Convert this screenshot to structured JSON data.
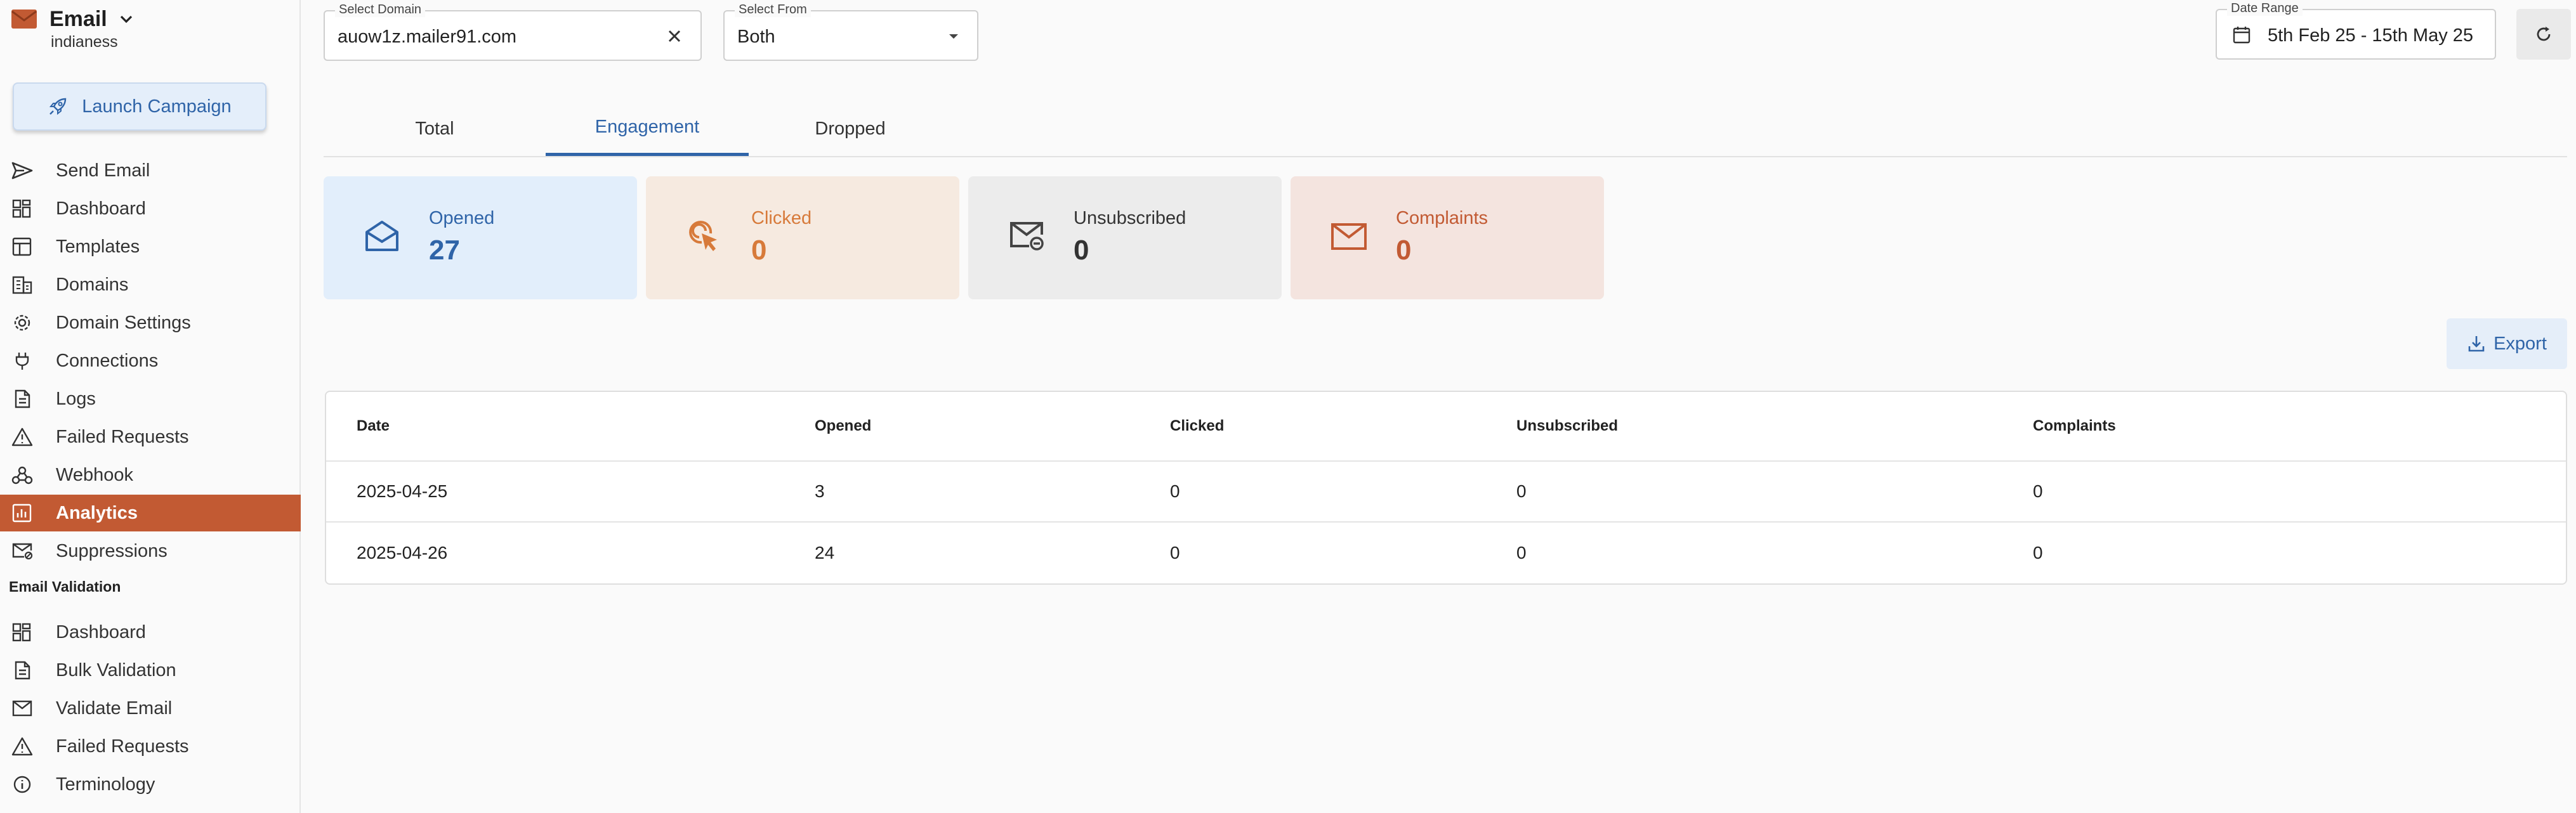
{
  "sidebar": {
    "brand_title": "Email",
    "brand_subtitle": "indianess",
    "launch_label": "Launch Campaign",
    "items": [
      {
        "label": "Send Email",
        "icon": "send-icon"
      },
      {
        "label": "Dashboard",
        "icon": "dashboard-icon"
      },
      {
        "label": "Templates",
        "icon": "templates-icon"
      },
      {
        "label": "Domains",
        "icon": "domains-icon"
      },
      {
        "label": "Domain Settings",
        "icon": "gear-icon"
      },
      {
        "label": "Connections",
        "icon": "plug-icon"
      },
      {
        "label": "Logs",
        "icon": "document-icon"
      },
      {
        "label": "Failed Requests",
        "icon": "warning-icon"
      },
      {
        "label": "Webhook",
        "icon": "webhook-icon"
      },
      {
        "label": "Analytics",
        "icon": "analytics-icon",
        "active": true
      },
      {
        "label": "Suppressions",
        "icon": "mail-block-icon"
      }
    ],
    "validation_section_title": "Email Validation",
    "validation_items": [
      {
        "label": "Dashboard",
        "icon": "dashboard-icon"
      },
      {
        "label": "Bulk Validation",
        "icon": "document-icon"
      },
      {
        "label": "Validate Email",
        "icon": "mail-icon"
      },
      {
        "label": "Failed Requests",
        "icon": "warning-icon"
      },
      {
        "label": "Terminology",
        "icon": "info-icon"
      }
    ]
  },
  "filters": {
    "domain_label": "Select Domain",
    "domain_value": "auow1z.mailer91.com",
    "from_label": "Select From",
    "from_value": "Both",
    "date_label": "Date Range",
    "date_value": "5th Feb 25 - 15th May 25"
  },
  "tabs": [
    "Total",
    "Engagement",
    "Dropped"
  ],
  "active_tab": "Engagement",
  "cards": [
    {
      "label": "Opened",
      "value": "27",
      "icon": "mail-open-icon"
    },
    {
      "label": "Clicked",
      "value": "0",
      "icon": "click-icon"
    },
    {
      "label": "Unsubscribed",
      "value": "0",
      "icon": "mail-unsubscribe-icon"
    },
    {
      "label": "Complaints",
      "value": "0",
      "icon": "mail-icon"
    }
  ],
  "export_label": "Export",
  "table": {
    "headers": [
      "Date",
      "Opened",
      "Clicked",
      "Unsubscribed",
      "Complaints"
    ],
    "rows": [
      [
        "2025-04-25",
        "3",
        "0",
        "0",
        "0"
      ],
      [
        "2025-04-26",
        "24",
        "0",
        "0",
        "0"
      ]
    ]
  },
  "colors": {
    "accent": "#c25a33",
    "primary": "#2f64a8",
    "opened_bg": "#e2eefb",
    "clicked_bg": "#f6eae0",
    "unsubscribed_bg": "#ececec",
    "complaints_bg": "#f4e4df"
  }
}
